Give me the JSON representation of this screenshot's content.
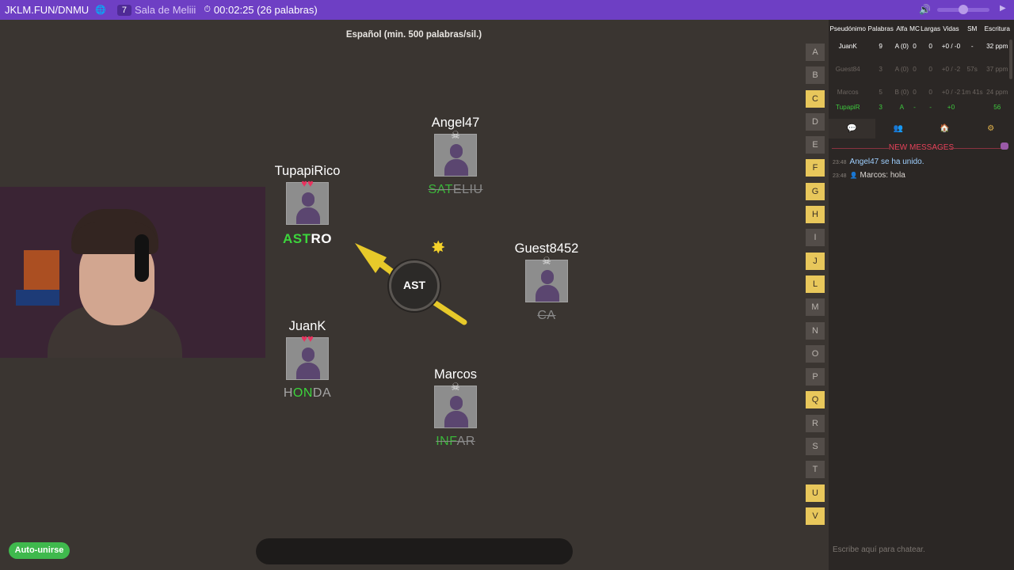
{
  "topbar": {
    "room_code": "JKLM.FUN/DNMU",
    "globe_icon": "🌐",
    "player_count": "7",
    "room_name": "Sala de Meliii",
    "timer_icon": "⏱",
    "timer": "00:02:25 (26 palabras)",
    "volume_icon": "🔊",
    "volume_level": 0.5,
    "play_icon": "▶"
  },
  "game": {
    "language": "Español (min. 500 palabras/sil.)",
    "syllable": "AST",
    "star_icon": "✸",
    "players": {
      "angel": {
        "name": "Angel47",
        "status": "☠",
        "word_hi": "SAT",
        "word_rest": "ELIU"
      },
      "tupapi": {
        "name": "TupapiRico",
        "status": "♥♥",
        "word_hi": "AST",
        "word_rest": "RO"
      },
      "guest": {
        "name": "Guest8452",
        "status": "☠",
        "word_hi": "",
        "word_rest": "CA"
      },
      "juank": {
        "name": "JuanK",
        "status": "♥♥",
        "word_hi": "H",
        "word_mid": "ON",
        "word_rest": "DA"
      },
      "marcos": {
        "name": "Marcos",
        "status": "☠",
        "word_hi": "INF",
        "word_rest": "AR"
      }
    },
    "letters": [
      "A",
      "B",
      "C",
      "D",
      "E",
      "F",
      "G",
      "H",
      "I",
      "J",
      "L",
      "M",
      "N",
      "O",
      "P",
      "Q",
      "R",
      "S",
      "T",
      "U",
      "V"
    ],
    "used_letters": [
      "C",
      "F",
      "G",
      "H",
      "J",
      "L",
      "Q",
      "U",
      "V"
    ],
    "auto_join": "Auto-unirse"
  },
  "side": {
    "headers": [
      "Pseudónimo",
      "Palabras",
      "Alfa",
      "MC",
      "Largas",
      "Vidas",
      "SM",
      "Escritura"
    ],
    "rows": [
      [
        "JuanK",
        "9",
        "A (0)",
        "0",
        "0",
        "+0 / -0",
        "-",
        "32 ppm"
      ],
      [
        "Guest84",
        "3",
        "A (0)",
        "0",
        "0",
        "+0 / -2",
        "57s",
        "37 ppm"
      ],
      [
        "Marcos",
        "5",
        "B (0)",
        "0",
        "0",
        "+0 / -2",
        "1m 41s",
        "24 ppm"
      ],
      [
        "TupapiR",
        "3",
        "A",
        "-",
        "-",
        "+0",
        "",
        "56"
      ]
    ],
    "tabs": [
      "💬",
      "👥",
      "🏠",
      "⚙"
    ],
    "new_messages": "NEW MESSAGES",
    "messages": [
      {
        "time": "23:48",
        "text": "Angel47 se ha unido.",
        "user": "",
        "user_icon": ""
      },
      {
        "time": "23:48",
        "text": "hola",
        "user": "Marcos:",
        "user_icon": "👤"
      }
    ],
    "chat_placeholder": "Escribe aquí para chatear."
  }
}
